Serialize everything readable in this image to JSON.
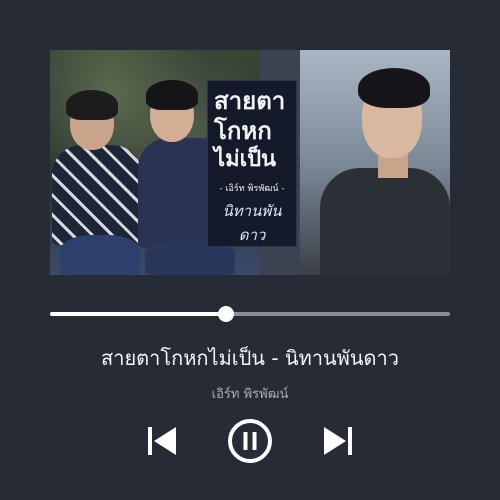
{
  "artwork": {
    "title_lines": [
      "สายตา",
      "โกหก",
      "ไม่เป็น"
    ],
    "artist_credit": "- เอิร์ท พิรพัฒน์ -",
    "drama_title": "นิทานพันดาว"
  },
  "player": {
    "song_title": "สายตาโกหกไม่เป็น - นิทานพันดาว",
    "artist": "เอิร์ท พิรพัฒน์",
    "progress_fraction": 0.44,
    "state": "playing"
  },
  "icons": {
    "previous": "skip-previous-icon",
    "pause": "pause-circle-icon",
    "next": "skip-next-icon"
  },
  "colors": {
    "background": "#272b35",
    "progress_fill": "#ffffff",
    "progress_track": "#8a8d94",
    "title": "#f5f5f5",
    "artist": "#a8abb2"
  }
}
